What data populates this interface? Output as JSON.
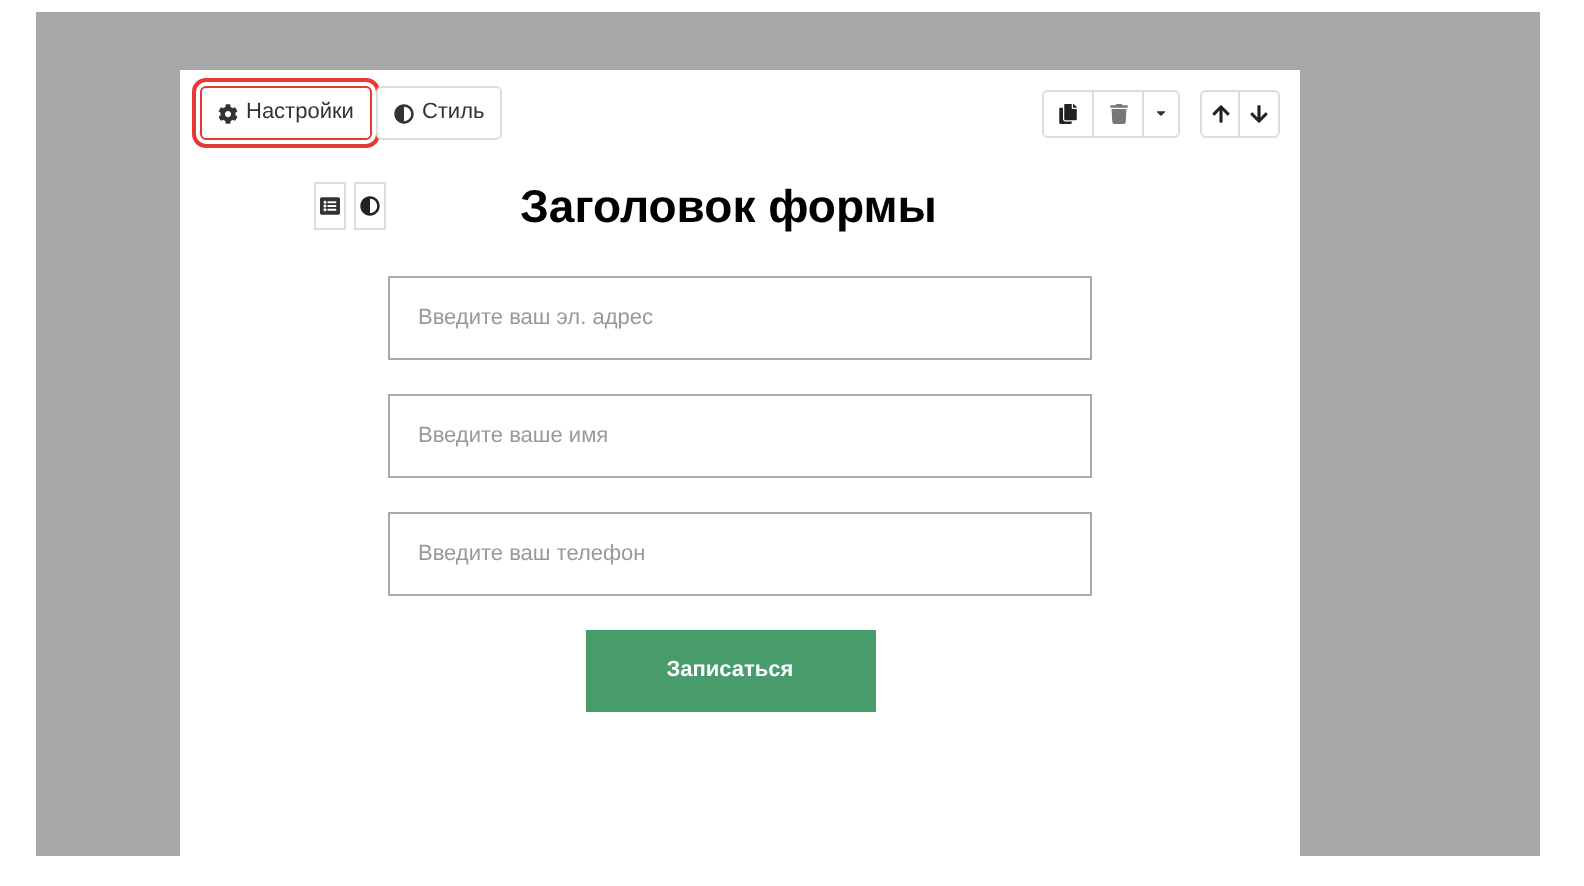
{
  "toolbar": {
    "tabs": [
      {
        "label": "Настройки",
        "kind": "settings",
        "highlighted": true
      },
      {
        "label": "Стиль",
        "kind": "style",
        "highlighted": false
      }
    ]
  },
  "form": {
    "title": "Заголовок формы",
    "fields": [
      {
        "placeholder": "Введите ваш эл. адрес"
      },
      {
        "placeholder": "Введите ваше имя"
      },
      {
        "placeholder": "Введите ваш телефон"
      }
    ],
    "submit": "Записаться"
  }
}
